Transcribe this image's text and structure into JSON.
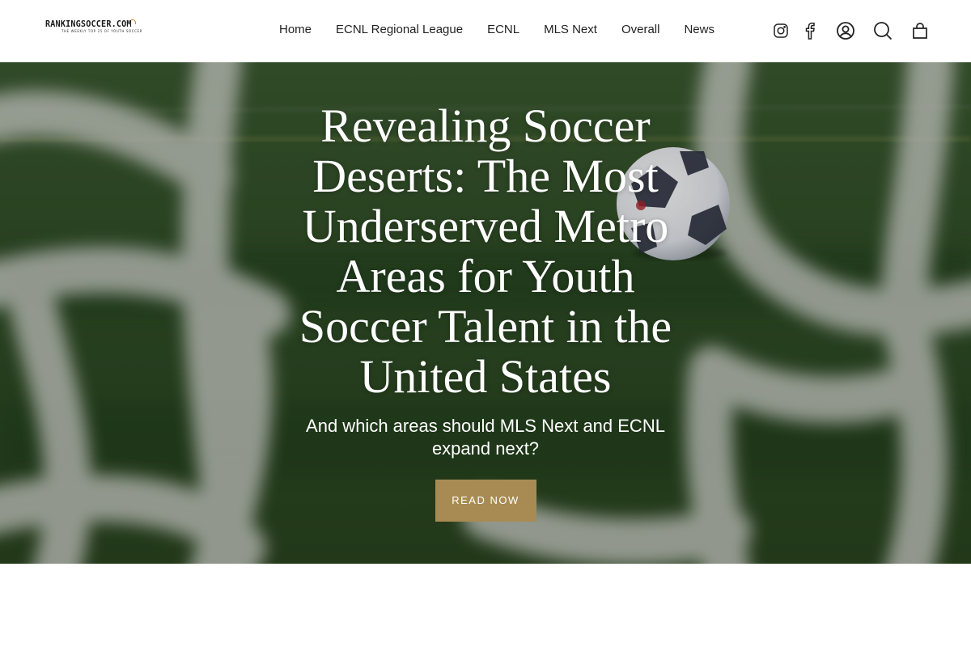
{
  "brand": {
    "logo_text": "RANKINGSOCCER.COM",
    "logo_tagline": "THE WEEKLY TOP 25 OF YOUTH SOCCER",
    "accent_color": "#d08b3b"
  },
  "nav": {
    "items": [
      {
        "label": "Home"
      },
      {
        "label": "ECNL Regional League"
      },
      {
        "label": "ECNL"
      },
      {
        "label": "MLS Next"
      },
      {
        "label": "Overall"
      },
      {
        "label": "News"
      }
    ]
  },
  "header_icons": [
    "instagram-icon",
    "facebook-icon",
    "account-icon",
    "search-icon",
    "cart-icon"
  ],
  "hero": {
    "title": "Revealing Soccer Deserts: The Most Underserved Metro Areas for Youth Soccer Talent in the United States",
    "subtitle": "And which areas should MLS Next and ECNL expand next?",
    "button_label": "READ NOW",
    "button_color": "#a88b52"
  }
}
